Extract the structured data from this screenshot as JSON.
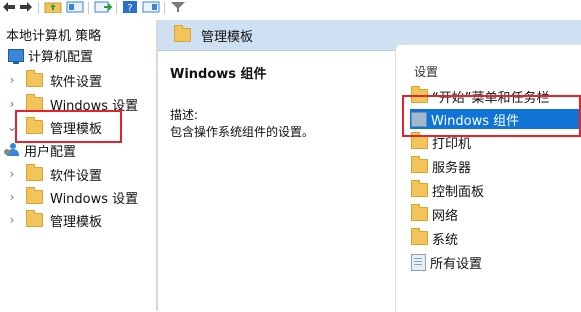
{
  "toolbar": {
    "buttons": [
      {
        "name": "back-arrow-icon"
      },
      {
        "name": "forward-arrow-icon"
      },
      {
        "name": "up-folder-icon"
      },
      {
        "name": "show-hide-tree-icon"
      },
      {
        "name": "export-list-icon"
      },
      {
        "name": "help-icon"
      },
      {
        "name": "extended-view-icon"
      },
      {
        "name": "filter-icon"
      }
    ]
  },
  "tree": {
    "root": "本地计算机 策略",
    "computer_config": "计算机配置",
    "computer_children": [
      "软件设置",
      "Windows 设置",
      "管理模板"
    ],
    "user_config": "用户配置",
    "user_children": [
      "软件设置",
      "Windows 设置",
      "管理模板"
    ]
  },
  "header": {
    "title": "管理模板"
  },
  "description": {
    "title": "Windows 组件",
    "label": "描述:",
    "text": "包含操作系统组件的设置。"
  },
  "list": {
    "column": "设置",
    "items": [
      {
        "label": "“开始”菜单和任务栏",
        "icon": "folder-icon"
      },
      {
        "label": "Windows 组件",
        "icon": "windows-components-icon",
        "selected": true
      },
      {
        "label": "打印机",
        "icon": "folder-icon"
      },
      {
        "label": "服务器",
        "icon": "folder-icon"
      },
      {
        "label": "控制面板",
        "icon": "folder-icon"
      },
      {
        "label": "网络",
        "icon": "folder-icon"
      },
      {
        "label": "系统",
        "icon": "folder-icon"
      },
      {
        "label": "所有设置",
        "icon": "all-settings-icon"
      }
    ]
  },
  "colors": {
    "selection": "#0f74d6",
    "header_bg": "#cfe0f2",
    "folder": "#f2c55c",
    "annotation_red": "#e3232d"
  }
}
